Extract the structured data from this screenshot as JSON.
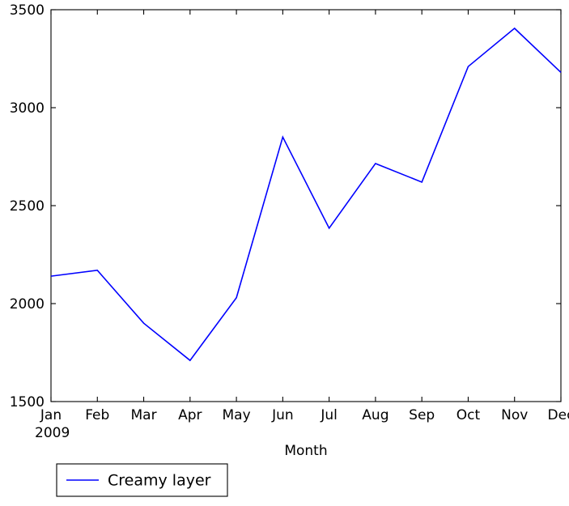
{
  "chart_data": {
    "type": "line",
    "title": "",
    "subtitle": "",
    "xlabel": "Month",
    "ylabel": "",
    "categories": [
      "Jan",
      "Feb",
      "Mar",
      "Apr",
      "May",
      "Jun",
      "Jul",
      "Aug",
      "Sep",
      "Oct",
      "Nov",
      "Dec"
    ],
    "x_sublabel": "2009",
    "series": [
      {
        "name": "Creamy layer",
        "color": "#0000ff",
        "values": [
          2140,
          2170,
          1900,
          1710,
          2030,
          2850,
          2385,
          2715,
          2620,
          3210,
          3405,
          3180
        ]
      }
    ],
    "ylim": [
      1500,
      3500
    ],
    "y_ticks": [
      "1500",
      "2000",
      "2500",
      "3000",
      "3500"
    ],
    "y_tick_values": [
      1500,
      2000,
      2500,
      3000,
      3500
    ],
    "grid": false,
    "legend_position": "below-left",
    "legend_entries": [
      {
        "label": "Creamy layer",
        "color": "#0000ff"
      }
    ]
  },
  "axes": {
    "x_axis_title": "Month",
    "x_year_label": "2009"
  },
  "legend": {
    "entry_label": "Creamy layer"
  }
}
